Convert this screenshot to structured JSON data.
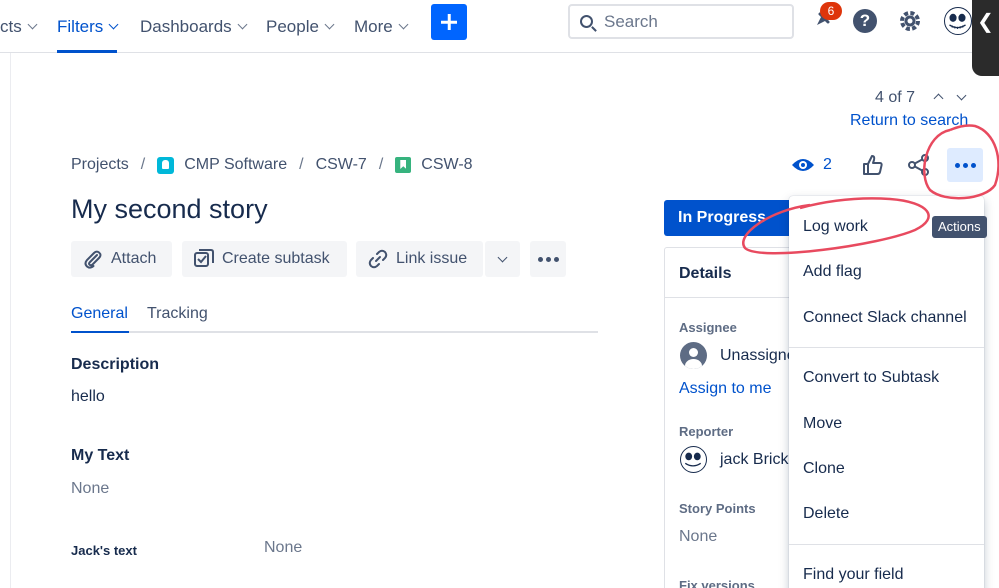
{
  "nav": {
    "items": [
      {
        "label": "cts"
      },
      {
        "label": "Filters"
      },
      {
        "label": "Dashboards"
      },
      {
        "label": "People"
      },
      {
        "label": "More"
      }
    ],
    "search_placeholder": "Search",
    "notification_count": "6",
    "help_label": "?",
    "side_handle": "❮"
  },
  "pager": {
    "position": "4 of 7",
    "return_label": "Return to search"
  },
  "breadcrumb": {
    "items": [
      "Projects",
      "CMP Software",
      "CSW-7",
      "CSW-8"
    ],
    "separator": "/"
  },
  "issue": {
    "title": "My second story",
    "watchers": "2",
    "status": "In Progress"
  },
  "actions": {
    "attach": "Attach",
    "create_subtask": "Create subtask",
    "link_issue": "Link issue"
  },
  "tabs": [
    {
      "label": "General"
    },
    {
      "label": "Tracking"
    }
  ],
  "fields": {
    "description_label": "Description",
    "description_value": "hello",
    "my_text_label": "My Text",
    "my_text_value": "None",
    "jacks_text_label": "Jack's text",
    "jacks_text_value": "None"
  },
  "details": {
    "title": "Details",
    "assignee_label": "Assignee",
    "assignee_value": "Unassigned",
    "assign_to_me": "Assign to me",
    "reporter_label": "Reporter",
    "reporter_value": "jack Brickey",
    "story_points_label": "Story Points",
    "story_points_value": "None",
    "fix_versions_label": "Fix versions"
  },
  "menu": {
    "items": [
      "Log work",
      "Add flag",
      "Connect Slack channel",
      "Convert to Subtask",
      "Move",
      "Clone",
      "Delete",
      "Find your field"
    ],
    "tooltip": "Actions"
  },
  "colors": {
    "primary": "#0052cc",
    "annotation": "#e84a5f"
  }
}
